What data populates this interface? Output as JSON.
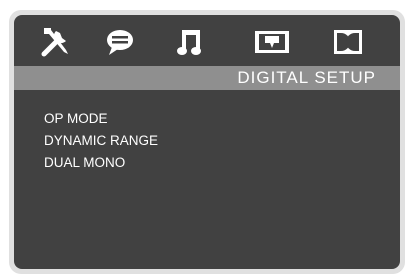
{
  "tabs": [
    {
      "icon": "tools-icon",
      "active": false
    },
    {
      "icon": "speech-bubble-icon",
      "active": false
    },
    {
      "icon": "music-note-icon",
      "active": false
    },
    {
      "icon": "video-screen-icon",
      "active": false
    },
    {
      "icon": "dolby-icon",
      "active": true
    }
  ],
  "header": {
    "title": "DIGITAL  SETUP"
  },
  "menu": {
    "items": [
      {
        "label": "OP MODE"
      },
      {
        "label": "DYNAMIC RANGE"
      },
      {
        "label": "DUAL MONO"
      }
    ]
  },
  "colors": {
    "background": "#414141",
    "title_bar": "#8f8f8f",
    "text": "#ffffff",
    "frame": "#e0e0e0"
  }
}
